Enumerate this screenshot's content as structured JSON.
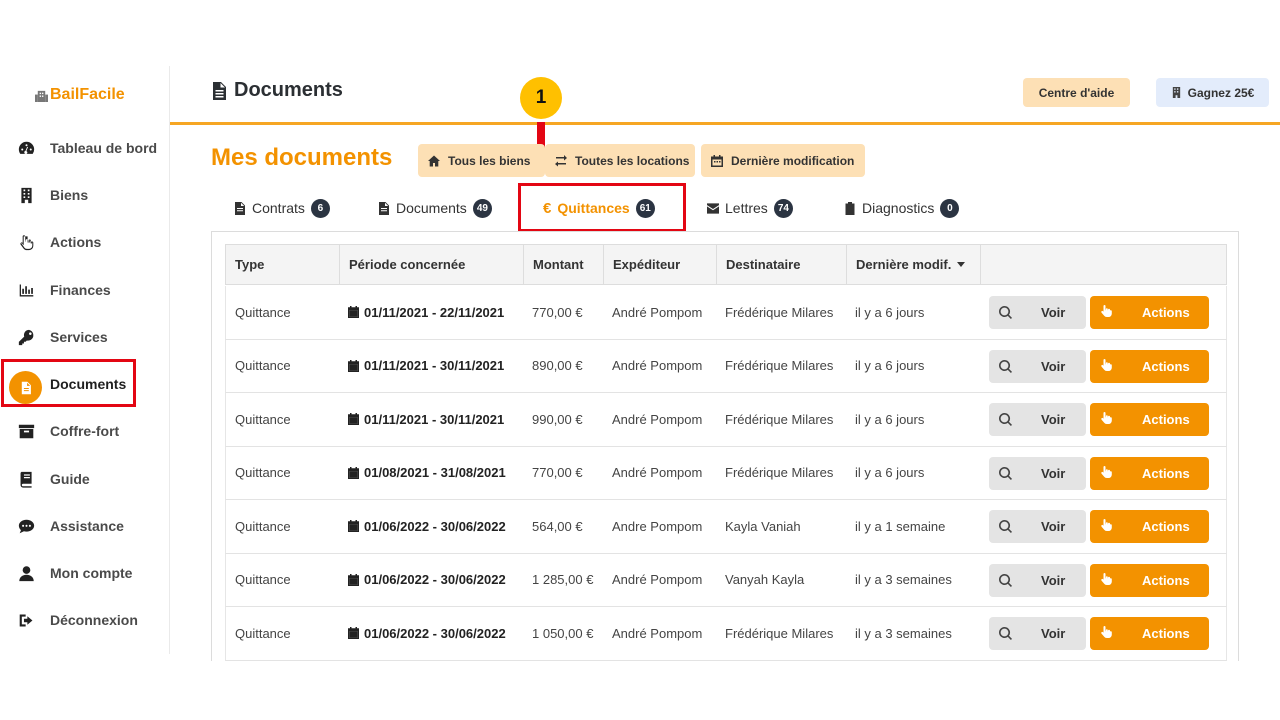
{
  "brand": {
    "name": "BailFacile"
  },
  "sidebar": {
    "items": [
      {
        "label": "Tableau de bord",
        "icon": "dashboard-gauge-icon"
      },
      {
        "label": "Biens",
        "icon": "building-icon"
      },
      {
        "label": "Actions",
        "icon": "pointing-hand-icon"
      },
      {
        "label": "Finances",
        "icon": "bar-chart-icon"
      },
      {
        "label": "Services",
        "icon": "key-icon"
      },
      {
        "label": "Documents",
        "icon": "document-icon",
        "active": true
      },
      {
        "label": "Coffre-fort",
        "icon": "archive-box-icon"
      },
      {
        "label": "Guide",
        "icon": "book-icon"
      },
      {
        "label": "Assistance",
        "icon": "chat-bubble-icon"
      },
      {
        "label": "Mon compte",
        "icon": "user-icon"
      },
      {
        "label": "Déconnexion",
        "icon": "sign-out-icon"
      }
    ]
  },
  "header": {
    "title": "Documents",
    "help_label": "Centre d'aide",
    "gagnez_label": "Gagnez 25€"
  },
  "annotation": {
    "step": "1",
    "highlight_color": "#e30613",
    "marker_color": "#ffc000"
  },
  "main": {
    "title": "Mes documents",
    "filters": [
      {
        "label": "Tous les biens",
        "icon": "home-icon"
      },
      {
        "label": "Toutes les locations",
        "icon": "exchange-icon"
      },
      {
        "label": "Dernière modification",
        "icon": "calendar-icon"
      }
    ],
    "tabs": [
      {
        "label": "Contrats",
        "count": "6",
        "icon": "file-icon"
      },
      {
        "label": "Documents",
        "count": "49",
        "icon": "file-icon"
      },
      {
        "label": "Quittances",
        "count": "61",
        "icon": "euro-icon",
        "active": true
      },
      {
        "label": "Lettres",
        "count": "74",
        "icon": "envelope-icon"
      },
      {
        "label": "Diagnostics",
        "count": "0",
        "icon": "clipboard-check-icon"
      }
    ]
  },
  "table": {
    "columns": [
      "Type",
      "Période concernée",
      "Montant",
      "Expéditeur",
      "Destinataire",
      "Dernière modif."
    ],
    "voir_label": "Voir",
    "actions_label": "Actions",
    "rows": [
      {
        "type": "Quittance",
        "period": "01/11/2021 - 22/11/2021",
        "amount": "770,00 €",
        "sender": "André Pompom",
        "recipient": "Frédérique Milares",
        "modified": "il y a 6 jours"
      },
      {
        "type": "Quittance",
        "period": "01/11/2021 - 30/11/2021",
        "amount": "890,00 €",
        "sender": "André Pompom",
        "recipient": "Frédérique Milares",
        "modified": "il y a 6 jours"
      },
      {
        "type": "Quittance",
        "period": "01/11/2021 - 30/11/2021",
        "amount": "990,00 €",
        "sender": "André Pompom",
        "recipient": "Frédérique Milares",
        "modified": "il y a 6 jours"
      },
      {
        "type": "Quittance",
        "period": "01/08/2021 - 31/08/2021",
        "amount": "770,00 €",
        "sender": "André Pompom",
        "recipient": "Frédérique Milares",
        "modified": "il y a 6 jours"
      },
      {
        "type": "Quittance",
        "period": "01/06/2022 - 30/06/2022",
        "amount": "564,00 €",
        "sender": "Andre Pompom",
        "recipient": "Kayla Vaniah",
        "modified": "il y a 1 semaine"
      },
      {
        "type": "Quittance",
        "period": "01/06/2022 - 30/06/2022",
        "amount": "1 285,00 €",
        "sender": "André Pompom",
        "recipient": "Vanyah Kayla",
        "modified": "il y a 3 semaines"
      },
      {
        "type": "Quittance",
        "period": "01/06/2022 - 30/06/2022",
        "amount": "1 050,00 €",
        "sender": "André Pompom",
        "recipient": "Frédérique Milares",
        "modified": "il y a 3 semaines"
      }
    ]
  },
  "colors": {
    "accent": "#f39200",
    "accent_light": "#fde0b5",
    "badge": "#2b3442"
  }
}
